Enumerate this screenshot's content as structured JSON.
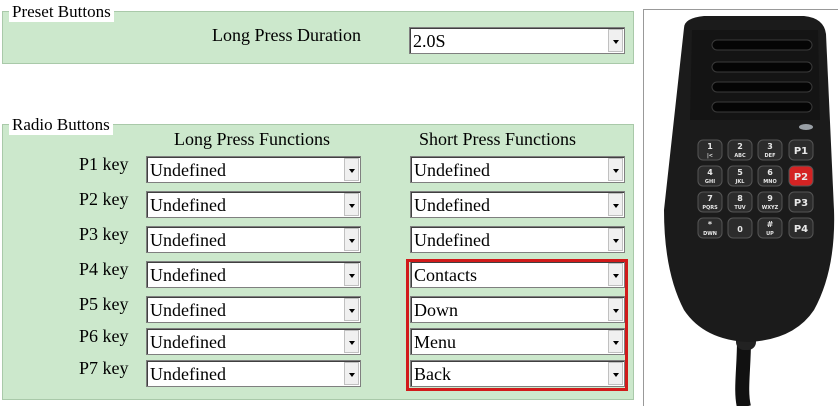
{
  "preset": {
    "legend": "Preset Buttons",
    "duration_label": "Long Press Duration",
    "duration_value": "2.0S"
  },
  "radio": {
    "legend": "Radio Buttons",
    "long_header": "Long Press Functions",
    "short_header": "Short Press Functions",
    "rows": [
      {
        "key": "P1 key",
        "long": "Undefined",
        "short": "Undefined"
      },
      {
        "key": "P2 key",
        "long": "Undefined",
        "short": "Undefined"
      },
      {
        "key": "P3 key",
        "long": "Undefined",
        "short": "Undefined"
      },
      {
        "key": "P4 key",
        "long": "Undefined",
        "short": "Contacts"
      },
      {
        "key": "P5 key",
        "long": "Undefined",
        "short": "Down"
      },
      {
        "key": "P6 key",
        "long": "Undefined",
        "short": "Menu"
      },
      {
        "key": "P7 key",
        "long": "Undefined",
        "short": "Back"
      }
    ]
  },
  "keypad": {
    "rows": [
      [
        "1\n|<",
        "2\nABC",
        "3\nDEF",
        "P1"
      ],
      [
        "4\nGHI",
        "5\nJKL",
        "6\nMNO",
        "P2"
      ],
      [
        "7\nPQRS",
        "8\nTUV",
        "9\nWXYZ",
        "P3"
      ],
      [
        "*\nDWN",
        "0",
        "#\nUP",
        "P4"
      ]
    ]
  },
  "colors": {
    "panel_bg": "#cce8cc",
    "highlight": "#d11a1a",
    "device_body": "#1b1b1b",
    "p2_key": "#d42323"
  }
}
